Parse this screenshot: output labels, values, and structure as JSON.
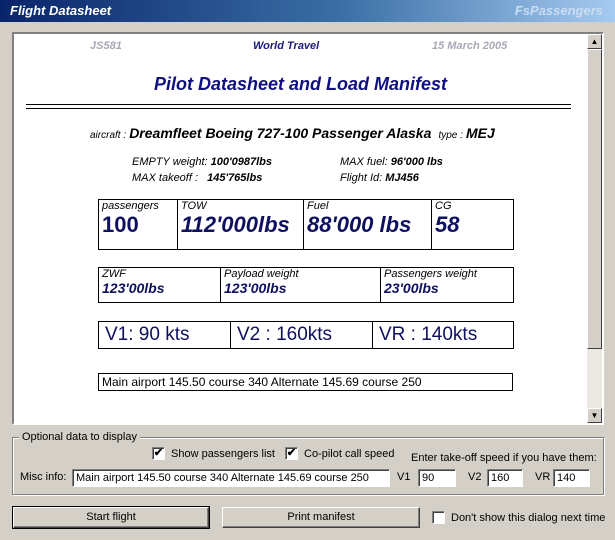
{
  "window": {
    "title": "Flight Datasheet",
    "brand": "FsPassengers"
  },
  "sheet": {
    "flight_id": "JS581",
    "airline": "World Travel",
    "date": "15 March 2005",
    "title": "Pilot Datasheet and Load Manifest",
    "aircraft_label": "aircraft :",
    "aircraft_name": "Dreamfleet Boeing 727-100 Passenger Alaska",
    "type_label": "type :",
    "type_value": "MEJ",
    "empty_weight_label": "EMPTY weight:",
    "empty_weight_value": "100'0987lbs",
    "max_fuel_label": "MAX fuel:",
    "max_fuel_value": "96'000 lbs",
    "max_takeoff_label": "MAX takeoff :",
    "max_takeoff_value": "145'765lbs",
    "flight_id_label": "Flight Id:",
    "flight_id_value": "MJ456",
    "load": [
      {
        "label": "passengers",
        "value": "100"
      },
      {
        "label": "TOW",
        "value": "112'000lbs"
      },
      {
        "label": "Fuel",
        "value": "88'000 lbs"
      },
      {
        "label": "CG",
        "value": "58"
      }
    ],
    "weights": [
      {
        "label": "ZWF",
        "value": "123'00lbs"
      },
      {
        "label": "Payload weight",
        "value": "123'00lbs"
      },
      {
        "label": "Passengers weight",
        "value": "23'00lbs"
      }
    ],
    "speeds": {
      "v1": "V1: 90 kts",
      "v2": "V2 : 160kts",
      "vr": "VR : 140kts"
    },
    "radio": "Main airport 145.50 course 340  Alternate 145.69 course 250"
  },
  "options": {
    "legend": "Optional data to display",
    "show_passengers_label": "Show passengers list",
    "show_passengers_checked": true,
    "copilot_label": "Co-pilot call speed",
    "copilot_checked": true,
    "speed_hint": "Enter take-off speed if you have them:",
    "misc_label": "Misc info:",
    "misc_value": "Main airport 145.50 course 340  Alternate 145.69 course 250",
    "v1_label": "V1",
    "v1_value": "90",
    "v2_label": "V2",
    "v2_value": "160",
    "vr_label": "VR",
    "vr_value": "140"
  },
  "footer": {
    "start_label": "Start flight",
    "print_label": "Print manifest",
    "dont_show_label": "Don't show this dialog next time",
    "dont_show_checked": false
  },
  "icons": {
    "check": "✔",
    "scroll_up": "▲",
    "scroll_down": "▼"
  }
}
